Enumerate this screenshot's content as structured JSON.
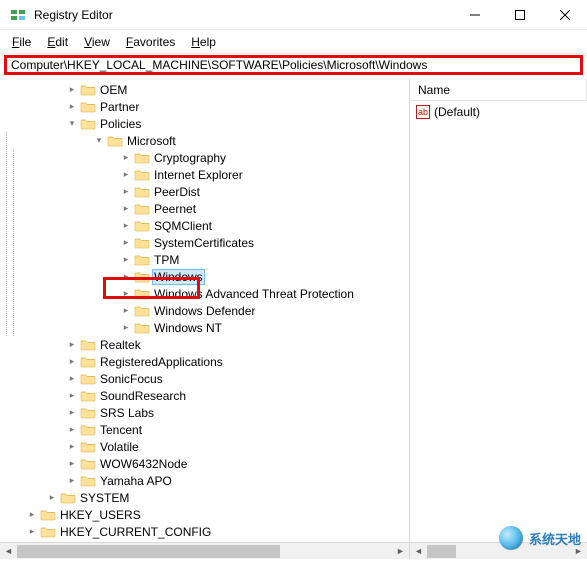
{
  "window": {
    "title": "Registry Editor"
  },
  "menu": {
    "file": "File",
    "edit": "Edit",
    "view": "View",
    "favorites": "Favorites",
    "help": "Help"
  },
  "address": {
    "value": "Computer\\HKEY_LOCAL_MACHINE\\SOFTWARE\\Policies\\Microsoft\\Windows"
  },
  "list": {
    "header": {
      "name": "Name"
    },
    "rows": [
      {
        "icon": "ab",
        "name": "(Default)"
      }
    ]
  },
  "tree": {
    "l1": [
      {
        "label": "OEM"
      },
      {
        "label": "Partner"
      },
      {
        "label": "Policies",
        "expanded": true
      },
      {
        "label": "Realtek"
      },
      {
        "label": "RegisteredApplications"
      },
      {
        "label": "SonicFocus"
      },
      {
        "label": "SoundResearch"
      },
      {
        "label": "SRS Labs"
      },
      {
        "label": "Tencent"
      },
      {
        "label": "Volatile"
      },
      {
        "label": "WOW6432Node"
      },
      {
        "label": "Yamaha APO"
      }
    ],
    "policies_children": [
      {
        "label": "Microsoft",
        "expanded": true
      }
    ],
    "microsoft_children": [
      {
        "label": "Cryptography"
      },
      {
        "label": "Internet Explorer"
      },
      {
        "label": "PeerDist"
      },
      {
        "label": "Peernet"
      },
      {
        "label": "SQMClient"
      },
      {
        "label": "SystemCertificates"
      },
      {
        "label": "TPM"
      },
      {
        "label": "Windows",
        "selected": true
      },
      {
        "label": "Windows Advanced Threat Protection"
      },
      {
        "label": "Windows Defender"
      },
      {
        "label": "Windows NT"
      }
    ],
    "after_software": [
      {
        "label": "SYSTEM"
      }
    ],
    "hives": [
      {
        "label": "HKEY_USERS"
      },
      {
        "label": "HKEY_CURRENT_CONFIG"
      }
    ]
  },
  "watermark": {
    "text": "系统天地"
  }
}
